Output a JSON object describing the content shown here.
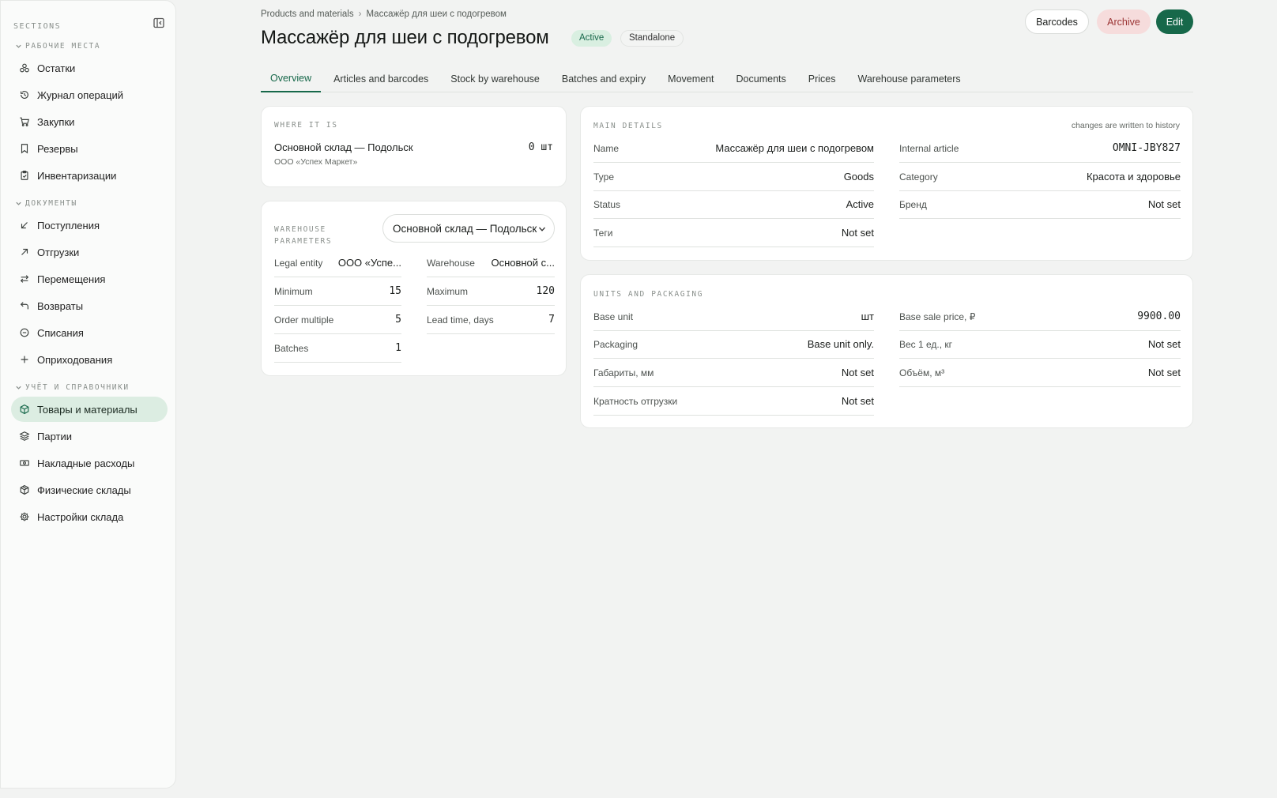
{
  "sidebar": {
    "title": "SECTIONS",
    "groups": [
      {
        "label": "РАБОЧИЕ МЕСТА",
        "items": [
          {
            "label": "Остатки",
            "icon": "stock-icon"
          },
          {
            "label": "Журнал операций",
            "icon": "history-icon"
          },
          {
            "label": "Закупки",
            "icon": "cart-icon"
          },
          {
            "label": "Резервы",
            "icon": "bookmark-icon"
          },
          {
            "label": "Инвентаризации",
            "icon": "clipboard-icon"
          }
        ]
      },
      {
        "label": "ДОКУМЕНТЫ",
        "items": [
          {
            "label": "Поступления",
            "icon": "arrow-down-left-icon"
          },
          {
            "label": "Отгрузки",
            "icon": "arrow-up-right-icon"
          },
          {
            "label": "Перемещения",
            "icon": "transfer-icon"
          },
          {
            "label": "Возвраты",
            "icon": "return-icon"
          },
          {
            "label": "Списания",
            "icon": "minus-circle-icon"
          },
          {
            "label": "Оприходования",
            "icon": "plus-icon"
          }
        ]
      },
      {
        "label": "УЧЁТ И СПРАВОЧНИКИ",
        "items": [
          {
            "label": "Товары и материалы",
            "icon": "box-icon",
            "active": true
          },
          {
            "label": "Партии",
            "icon": "layers-icon"
          },
          {
            "label": "Накладные расходы",
            "icon": "banknote-icon"
          },
          {
            "label": "Физические склады",
            "icon": "package-icon"
          },
          {
            "label": "Настройки склада",
            "icon": "gear-icon"
          }
        ]
      }
    ]
  },
  "header": {
    "breadcrumb": [
      "Products and materials",
      "Массажёр для шеи с подогревом"
    ],
    "breadcrumb_separator": "›",
    "title": "Массажёр для шеи с подогревом",
    "status_badge": "Active",
    "type_badge": "Standalone",
    "buttons": {
      "barcodes": "Barcodes",
      "archive": "Archive",
      "edit": "Edit"
    }
  },
  "tabs": [
    "Overview",
    "Articles and barcodes",
    "Stock by warehouse",
    "Batches and expiry",
    "Movement",
    "Documents",
    "Prices",
    "Warehouse parameters"
  ],
  "where": {
    "label": "WHERE IT IS",
    "warehouse": "Основной склад — Подольск",
    "org": "ООО «Успех Маркет»",
    "qty": "0 шт"
  },
  "params": {
    "label": "WAREHOUSE PARAMETERS",
    "selected_warehouse": "Основной склад — Подольск",
    "left": [
      {
        "label": "Legal entity",
        "value": "ООО «Успе..."
      },
      {
        "label": "Minimum",
        "value": "15"
      },
      {
        "label": "Order multiple",
        "value": "5"
      },
      {
        "label": "Batches",
        "value": "1"
      }
    ],
    "right": [
      {
        "label": "Warehouse",
        "value": "Основной с..."
      },
      {
        "label": "Maximum",
        "value": "120"
      },
      {
        "label": "Lead time, days",
        "value": "7"
      }
    ]
  },
  "main_details": {
    "label": "MAIN DETAILS",
    "note": "changes are written to history",
    "left": [
      {
        "label": "Name",
        "value": "Массажёр для шеи с подогревом"
      },
      {
        "label": "Type",
        "value": "Goods"
      },
      {
        "label": "Status",
        "value": "Active"
      },
      {
        "label": "Теги",
        "value": "Not set"
      }
    ],
    "right": [
      {
        "label": "Internal article",
        "value": "OMNI-JBY827"
      },
      {
        "label": "Category",
        "value": "Красота и здоровье"
      },
      {
        "label": "Бренд",
        "value": "Not set"
      }
    ]
  },
  "units": {
    "label": "UNITS AND PACKAGING",
    "left": [
      {
        "label": "Base unit",
        "value": "шт"
      },
      {
        "label": "Packaging",
        "value": "Base unit only."
      },
      {
        "label": "Габариты, мм",
        "value": "Not set"
      },
      {
        "label": "Кратность отгрузки",
        "value": "Not set"
      }
    ],
    "right": [
      {
        "label": "Base sale price, ₽",
        "value": "9900.00"
      },
      {
        "label": "Вес 1 ед., кг",
        "value": "Not set"
      },
      {
        "label": "Объём, м³",
        "value": "Not set"
      }
    ]
  },
  "colors": {
    "accent": "#17684a",
    "accent_soft": "#dcede2",
    "danger_soft": "#f6dcdc",
    "danger": "#9b3434"
  }
}
